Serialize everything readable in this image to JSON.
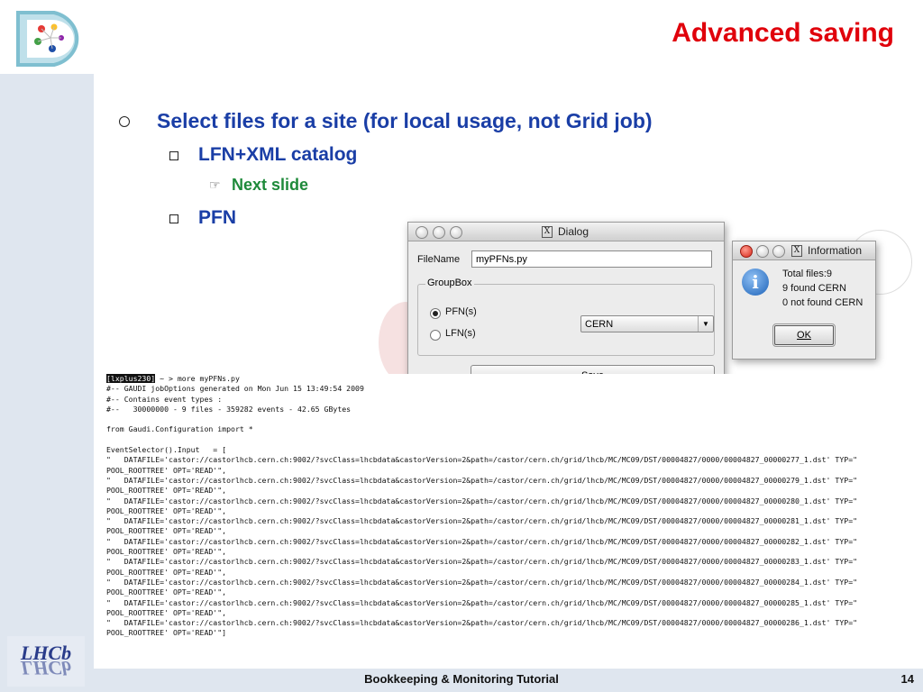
{
  "slide": {
    "title": "Advanced saving",
    "bullets": {
      "level1": "Select files for a site (for local usage, not Grid job)",
      "lfn": "LFN+XML catalog",
      "next": "Next slide",
      "pfn": "PFN"
    },
    "footer": "Bookkeeping & Monitoring Tutorial",
    "page_number": "14",
    "logo_text": "LHCb"
  },
  "dialog": {
    "title": "Dialog",
    "title_icon": "X",
    "filename_label": "FileName",
    "filename_value": "myPFNs.py",
    "groupbox_title": "GroupBox",
    "radio_pfn": "PFN(s)",
    "radio_lfn": "LFN(s)",
    "selected": "PFN(s)",
    "site_value": "CERN",
    "save_label": "Save"
  },
  "info": {
    "title": "Information",
    "title_icon": "X",
    "icon": "i",
    "lines": [
      "Total files:9",
      "9 found CERN",
      "0 not found CERN"
    ],
    "ok_label": "OK"
  },
  "terminal": {
    "prompt": "[lxplus230]",
    "command": " ~ > more myPFNs.py",
    "lines": [
      "#-- GAUDI jobOptions generated on Mon Jun 15 13:49:54 2009",
      "#-- Contains event types :",
      "#--   30000000 - 9 files - 359282 events - 42.65 GBytes",
      "",
      "from Gaudi.Configuration import *",
      "",
      "EventSelector().Input   = [",
      "\"   DATAFILE='castor://castorlhcb.cern.ch:9002/?svcClass=lhcbdata&castorVersion=2&path=/castor/cern.ch/grid/lhcb/MC/MC09/DST/00004827/0000/00004827_00000277_1.dst' TYP=\"",
      "POOL_ROOTTREE' OPT='READ'\",",
      "\"   DATAFILE='castor://castorlhcb.cern.ch:9002/?svcClass=lhcbdata&castorVersion=2&path=/castor/cern.ch/grid/lhcb/MC/MC09/DST/00004827/0000/00004827_00000279_1.dst' TYP=\"",
      "POOL_ROOTTREE' OPT='READ'\",",
      "\"   DATAFILE='castor://castorlhcb.cern.ch:9002/?svcClass=lhcbdata&castorVersion=2&path=/castor/cern.ch/grid/lhcb/MC/MC09/DST/00004827/0000/00004827_00000280_1.dst' TYP=\"",
      "POOL_ROOTTREE' OPT='READ'\",",
      "\"   DATAFILE='castor://castorlhcb.cern.ch:9002/?svcClass=lhcbdata&castorVersion=2&path=/castor/cern.ch/grid/lhcb/MC/MC09/DST/00004827/0000/00004827_00000281_1.dst' TYP=\"",
      "POOL_ROOTTREE' OPT='READ'\",",
      "\"   DATAFILE='castor://castorlhcb.cern.ch:9002/?svcClass=lhcbdata&castorVersion=2&path=/castor/cern.ch/grid/lhcb/MC/MC09/DST/00004827/0000/00004827_00000282_1.dst' TYP=\"",
      "POOL_ROOTTREE' OPT='READ'\",",
      "\"   DATAFILE='castor://castorlhcb.cern.ch:9002/?svcClass=lhcbdata&castorVersion=2&path=/castor/cern.ch/grid/lhcb/MC/MC09/DST/00004827/0000/00004827_00000283_1.dst' TYP=\"",
      "POOL_ROOTTREE' OPT='READ'\",",
      "\"   DATAFILE='castor://castorlhcb.cern.ch:9002/?svcClass=lhcbdata&castorVersion=2&path=/castor/cern.ch/grid/lhcb/MC/MC09/DST/00004827/0000/00004827_00000284_1.dst' TYP=\"",
      "POOL_ROOTTREE' OPT='READ'\",",
      "\"   DATAFILE='castor://castorlhcb.cern.ch:9002/?svcClass=lhcbdata&castorVersion=2&path=/castor/cern.ch/grid/lhcb/MC/MC09/DST/00004827/0000/00004827_00000285_1.dst' TYP=\"",
      "POOL_ROOTTREE' OPT='READ'\",",
      "\"   DATAFILE='castor://castorlhcb.cern.ch:9002/?svcClass=lhcbdata&castorVersion=2&path=/castor/cern.ch/grid/lhcb/MC/MC09/DST/00004827/0000/00004827_00000286_1.dst' TYP=\"",
      "POOL_ROOTTREE' OPT='READ'\"]"
    ]
  },
  "colors": {
    "title_red": "#e0000b",
    "bullet_blue": "#1a3ea6",
    "bullet_green": "#1e8a3a",
    "band": "#dfe6ef"
  }
}
